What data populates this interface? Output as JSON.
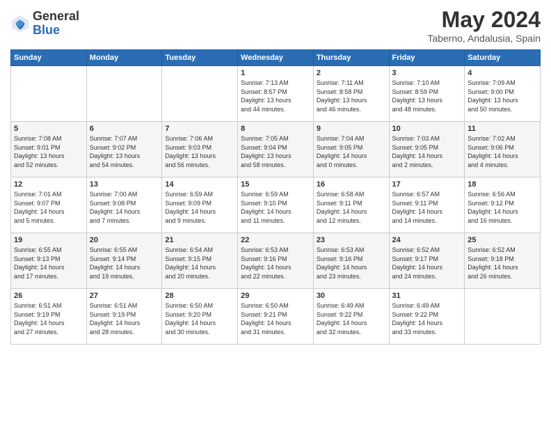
{
  "logo": {
    "general": "General",
    "blue": "Blue"
  },
  "title": {
    "month_year": "May 2024",
    "location": "Taberno, Andalusia, Spain"
  },
  "headers": [
    "Sunday",
    "Monday",
    "Tuesday",
    "Wednesday",
    "Thursday",
    "Friday",
    "Saturday"
  ],
  "weeks": [
    [
      {
        "day": "",
        "info": ""
      },
      {
        "day": "",
        "info": ""
      },
      {
        "day": "",
        "info": ""
      },
      {
        "day": "1",
        "info": "Sunrise: 7:13 AM\nSunset: 8:57 PM\nDaylight: 13 hours\nand 44 minutes."
      },
      {
        "day": "2",
        "info": "Sunrise: 7:11 AM\nSunset: 8:58 PM\nDaylight: 13 hours\nand 46 minutes."
      },
      {
        "day": "3",
        "info": "Sunrise: 7:10 AM\nSunset: 8:59 PM\nDaylight: 13 hours\nand 48 minutes."
      },
      {
        "day": "4",
        "info": "Sunrise: 7:09 AM\nSunset: 9:00 PM\nDaylight: 13 hours\nand 50 minutes."
      }
    ],
    [
      {
        "day": "5",
        "info": "Sunrise: 7:08 AM\nSunset: 9:01 PM\nDaylight: 13 hours\nand 52 minutes."
      },
      {
        "day": "6",
        "info": "Sunrise: 7:07 AM\nSunset: 9:02 PM\nDaylight: 13 hours\nand 54 minutes."
      },
      {
        "day": "7",
        "info": "Sunrise: 7:06 AM\nSunset: 9:03 PM\nDaylight: 13 hours\nand 56 minutes."
      },
      {
        "day": "8",
        "info": "Sunrise: 7:05 AM\nSunset: 9:04 PM\nDaylight: 13 hours\nand 58 minutes."
      },
      {
        "day": "9",
        "info": "Sunrise: 7:04 AM\nSunset: 9:05 PM\nDaylight: 14 hours\nand 0 minutes."
      },
      {
        "day": "10",
        "info": "Sunrise: 7:03 AM\nSunset: 9:05 PM\nDaylight: 14 hours\nand 2 minutes."
      },
      {
        "day": "11",
        "info": "Sunrise: 7:02 AM\nSunset: 9:06 PM\nDaylight: 14 hours\nand 4 minutes."
      }
    ],
    [
      {
        "day": "12",
        "info": "Sunrise: 7:01 AM\nSunset: 9:07 PM\nDaylight: 14 hours\nand 5 minutes."
      },
      {
        "day": "13",
        "info": "Sunrise: 7:00 AM\nSunset: 9:08 PM\nDaylight: 14 hours\nand 7 minutes."
      },
      {
        "day": "14",
        "info": "Sunrise: 6:59 AM\nSunset: 9:09 PM\nDaylight: 14 hours\nand 9 minutes."
      },
      {
        "day": "15",
        "info": "Sunrise: 6:59 AM\nSunset: 9:10 PM\nDaylight: 14 hours\nand 11 minutes."
      },
      {
        "day": "16",
        "info": "Sunrise: 6:58 AM\nSunset: 9:11 PM\nDaylight: 14 hours\nand 12 minutes."
      },
      {
        "day": "17",
        "info": "Sunrise: 6:57 AM\nSunset: 9:11 PM\nDaylight: 14 hours\nand 14 minutes."
      },
      {
        "day": "18",
        "info": "Sunrise: 6:56 AM\nSunset: 9:12 PM\nDaylight: 14 hours\nand 16 minutes."
      }
    ],
    [
      {
        "day": "19",
        "info": "Sunrise: 6:55 AM\nSunset: 9:13 PM\nDaylight: 14 hours\nand 17 minutes."
      },
      {
        "day": "20",
        "info": "Sunrise: 6:55 AM\nSunset: 9:14 PM\nDaylight: 14 hours\nand 19 minutes."
      },
      {
        "day": "21",
        "info": "Sunrise: 6:54 AM\nSunset: 9:15 PM\nDaylight: 14 hours\nand 20 minutes."
      },
      {
        "day": "22",
        "info": "Sunrise: 6:53 AM\nSunset: 9:16 PM\nDaylight: 14 hours\nand 22 minutes."
      },
      {
        "day": "23",
        "info": "Sunrise: 6:53 AM\nSunset: 9:16 PM\nDaylight: 14 hours\nand 23 minutes."
      },
      {
        "day": "24",
        "info": "Sunrise: 6:52 AM\nSunset: 9:17 PM\nDaylight: 14 hours\nand 24 minutes."
      },
      {
        "day": "25",
        "info": "Sunrise: 6:52 AM\nSunset: 9:18 PM\nDaylight: 14 hours\nand 26 minutes."
      }
    ],
    [
      {
        "day": "26",
        "info": "Sunrise: 6:51 AM\nSunset: 9:19 PM\nDaylight: 14 hours\nand 27 minutes."
      },
      {
        "day": "27",
        "info": "Sunrise: 6:51 AM\nSunset: 9:19 PM\nDaylight: 14 hours\nand 28 minutes."
      },
      {
        "day": "28",
        "info": "Sunrise: 6:50 AM\nSunset: 9:20 PM\nDaylight: 14 hours\nand 30 minutes."
      },
      {
        "day": "29",
        "info": "Sunrise: 6:50 AM\nSunset: 9:21 PM\nDaylight: 14 hours\nand 31 minutes."
      },
      {
        "day": "30",
        "info": "Sunrise: 6:49 AM\nSunset: 9:22 PM\nDaylight: 14 hours\nand 32 minutes."
      },
      {
        "day": "31",
        "info": "Sunrise: 6:49 AM\nSunset: 9:22 PM\nDaylight: 14 hours\nand 33 minutes."
      },
      {
        "day": "",
        "info": ""
      }
    ]
  ]
}
